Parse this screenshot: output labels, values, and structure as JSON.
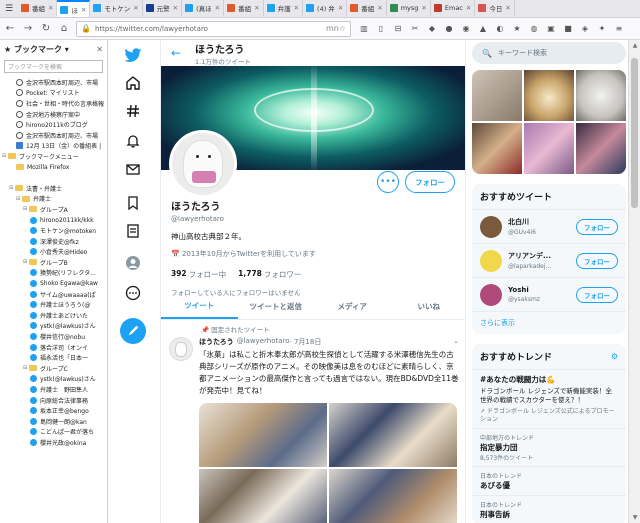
{
  "browser": {
    "tabs": [
      {
        "label": "番組",
        "color": "#e05a2b"
      },
      {
        "label": "ほ",
        "color": "#1da1f2",
        "active": true
      },
      {
        "label": "モトケン",
        "color": "#1da1f2"
      },
      {
        "label": "元警",
        "color": "#1a3c8e"
      },
      {
        "label": "(真ほ",
        "color": "#1da1f2"
      },
      {
        "label": "番組",
        "color": "#e05a2b"
      },
      {
        "label": "弁護",
        "color": "#1da1f2"
      },
      {
        "label": "(4) 弁",
        "color": "#1da1f2"
      },
      {
        "label": "番組",
        "color": "#e05a2b"
      },
      {
        "label": "mysg",
        "color": "#2e8b57"
      },
      {
        "label": "Emac",
        "color": "#c0392b"
      },
      {
        "label": "今日",
        "color": "#d9534f"
      }
    ],
    "url": "https://twitter.com/lawyerhotaro",
    "url_suffix": "mn"
  },
  "sidebar": {
    "title": "ブックマーク",
    "search_placeholder": "ブックマークを検索",
    "items": [
      {
        "label": "金沢市駅西本町周辺、市場",
        "icon": "globe",
        "indent": 2
      },
      {
        "label": "Pocket: マイリスト",
        "icon": "globe",
        "indent": 2
      },
      {
        "label": "社会・世相・時代の言承格報",
        "icon": "globe",
        "indent": 2
      },
      {
        "label": "金沢地方検察庁案中",
        "icon": "globe",
        "indent": 2
      },
      {
        "label": "hirono2011kのブログ",
        "icon": "globe",
        "indent": 2
      },
      {
        "label": "金沢市駅西本町周辺、市場",
        "icon": "globe",
        "indent": 2
      },
      {
        "label": "12月 13日（金）の番組表 |",
        "icon": "calendar",
        "indent": 2
      },
      {
        "label": "ブックマークメニュー",
        "icon": "folder",
        "indent": 0,
        "toggle": "⊟"
      },
      {
        "label": "Mozilla Firefox",
        "icon": "folder",
        "indent": 2
      },
      {
        "label": "",
        "icon": "none",
        "indent": 0
      },
      {
        "label": "法曹・弁護士",
        "icon": "folder",
        "indent": 1,
        "toggle": "⊟"
      },
      {
        "label": "弁護士",
        "icon": "folder",
        "indent": 2,
        "toggle": "⊟"
      },
      {
        "label": "グループA",
        "icon": "folder",
        "indent": 3,
        "toggle": "⊟"
      },
      {
        "label": "hirono2011kk/kkk",
        "icon": "tw",
        "indent": 4
      },
      {
        "label": "モトケン@motoken",
        "icon": "tw",
        "indent": 4
      },
      {
        "label": "深澤俊史@fkz",
        "icon": "tw",
        "indent": 4
      },
      {
        "label": "小倉秀夫@Hideo",
        "icon": "tw",
        "indent": 4
      },
      {
        "label": "グループB",
        "icon": "folder",
        "indent": 3,
        "toggle": "⊟"
      },
      {
        "label": "猿勢紀(リフレクタ...",
        "icon": "tw",
        "indent": 4
      },
      {
        "label": "Shoko Egawa@kaw",
        "icon": "tw",
        "indent": 4
      },
      {
        "label": "サイム@uwaaaa(ぱ",
        "icon": "tw",
        "indent": 4
      },
      {
        "label": "弁護士ほうろう(@",
        "icon": "tw",
        "indent": 4
      },
      {
        "label": "弁護士あどけいた",
        "icon": "tw",
        "indent": 4
      },
      {
        "label": "ystk(@lawkus)さん",
        "icon": "tw",
        "indent": 4
      },
      {
        "label": "櫻井信行@nobu",
        "icon": "tw",
        "indent": 4
      },
      {
        "label": "落合洋司（オンイ",
        "icon": "tw",
        "indent": 4
      },
      {
        "label": "福永活也「日本一",
        "icon": "tw",
        "indent": 4
      },
      {
        "label": "グループC",
        "icon": "folder",
        "indent": 3,
        "toggle": "⊟"
      },
      {
        "label": "ystk(@lawkus)さん",
        "icon": "tw",
        "indent": 4
      },
      {
        "label": "弁護士　野田隼人",
        "icon": "tw",
        "indent": 4
      },
      {
        "label": "向原総合法律事務",
        "icon": "tw",
        "indent": 4
      },
      {
        "label": "坂本正幸@bengo",
        "icon": "tw",
        "indent": 4
      },
      {
        "label": "島岡健一朗@kan",
        "icon": "tw",
        "indent": 4
      },
      {
        "label": "こどんぱ一君が落ち",
        "icon": "tw",
        "indent": 4
      },
      {
        "label": "櫻井光政@okina",
        "icon": "tw",
        "indent": 4
      }
    ]
  },
  "profile": {
    "name": "ほうたろう",
    "tweet_count": "1.1万件のツイート",
    "handle": "@lawyerhotaro",
    "bio": "神山高校古典部２年。",
    "joined": "2013年10月からTwitterを利用しています",
    "following_count": "392",
    "following_label": "フォロー中",
    "followers_count": "1,778",
    "followers_label": "フォロワー",
    "no_mutual": "フォローしている人にフォロワーはいません",
    "follow_label": "フォロー",
    "more_label": "•••"
  },
  "profile_tabs": [
    "ツイート",
    "ツイートと返信",
    "メディア",
    "いいね"
  ],
  "pinned_tweet": {
    "pinned_label": "固定されたツイート",
    "name": "ほうたろう",
    "handle": "@lawyerhotaro",
    "date": "· 7月18日",
    "text": "「氷菓」は私こと折木奉太郎が高校生探偵として活躍する米澤穂信先生の古典部シリーズが原作のアニメ。その映像美は息をのむほどに素晴らしく、京都アニメーションの最高傑作と言っても過言ではない。現在BD&DVD全11巻が発売中！見てね！"
  },
  "right": {
    "search_placeholder": "キーワード検索",
    "recommend_title": "おすすめツイート",
    "recommend": [
      {
        "name": "北白川",
        "handle": "@GUv4i6",
        "color": "#7a5a3a"
      },
      {
        "name": "アリアンデ...",
        "handle": "@laparkadej...",
        "color": "#f0d84a"
      },
      {
        "name": "Yoshi",
        "handle": "@ysaksmz",
        "color": "#b04a7a"
      }
    ],
    "follow_label": "フォロー",
    "more_label": "さらに表示",
    "trends_title": "おすすめトレンド",
    "trends": [
      {
        "tag": "#あなたの戦闘力は💪",
        "desc": "ドラゴンボール レジェンズで新機能実装！全世界の戦績でスカウターを使え？！",
        "promo": "ドラゴンボール レジェンズ公式によるプロモーション",
        "meta": ""
      },
      {
        "tag": "指定暴力団",
        "desc": "",
        "promo": "",
        "meta": "中部地方のトレンド",
        "count": "8,573件のツイート"
      },
      {
        "tag": "あびる優",
        "desc": "",
        "promo": "",
        "meta": "日本のトレンド"
      },
      {
        "tag": "刑事告訴",
        "desc": "",
        "promo": "",
        "meta": "日本のトレンド"
      }
    ]
  }
}
